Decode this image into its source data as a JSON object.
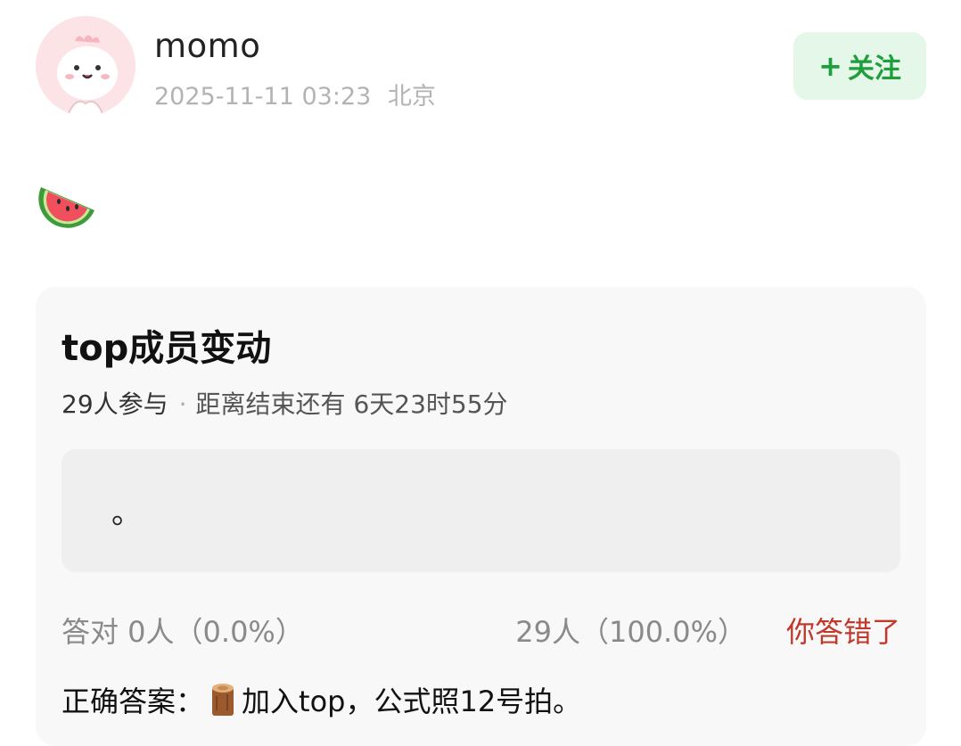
{
  "post": {
    "username": "momo",
    "timestamp": "2025-11-11 03:23",
    "location": "北京",
    "follow_label": "关注",
    "content_emoji": "watermelon-icon"
  },
  "quiz": {
    "title": "top成员变动",
    "participants": "29人参与",
    "separator": "·",
    "time_remaining": "距离结束还有 6天23时55分",
    "option_text": "。",
    "correct_stat": "答对  0人（0.0%）",
    "wrong_stat": "29人（100.0%）",
    "verdict": "你答错了",
    "answer_label": "正确答案：",
    "answer_icon": "log-icon",
    "answer_text": "加入top，公式照12号拍。"
  },
  "colors": {
    "follow_bg": "#e4f7e8",
    "follow_text": "#1f9e3d",
    "verdict": "#c0392b",
    "card_bg": "#f8f8f8"
  }
}
